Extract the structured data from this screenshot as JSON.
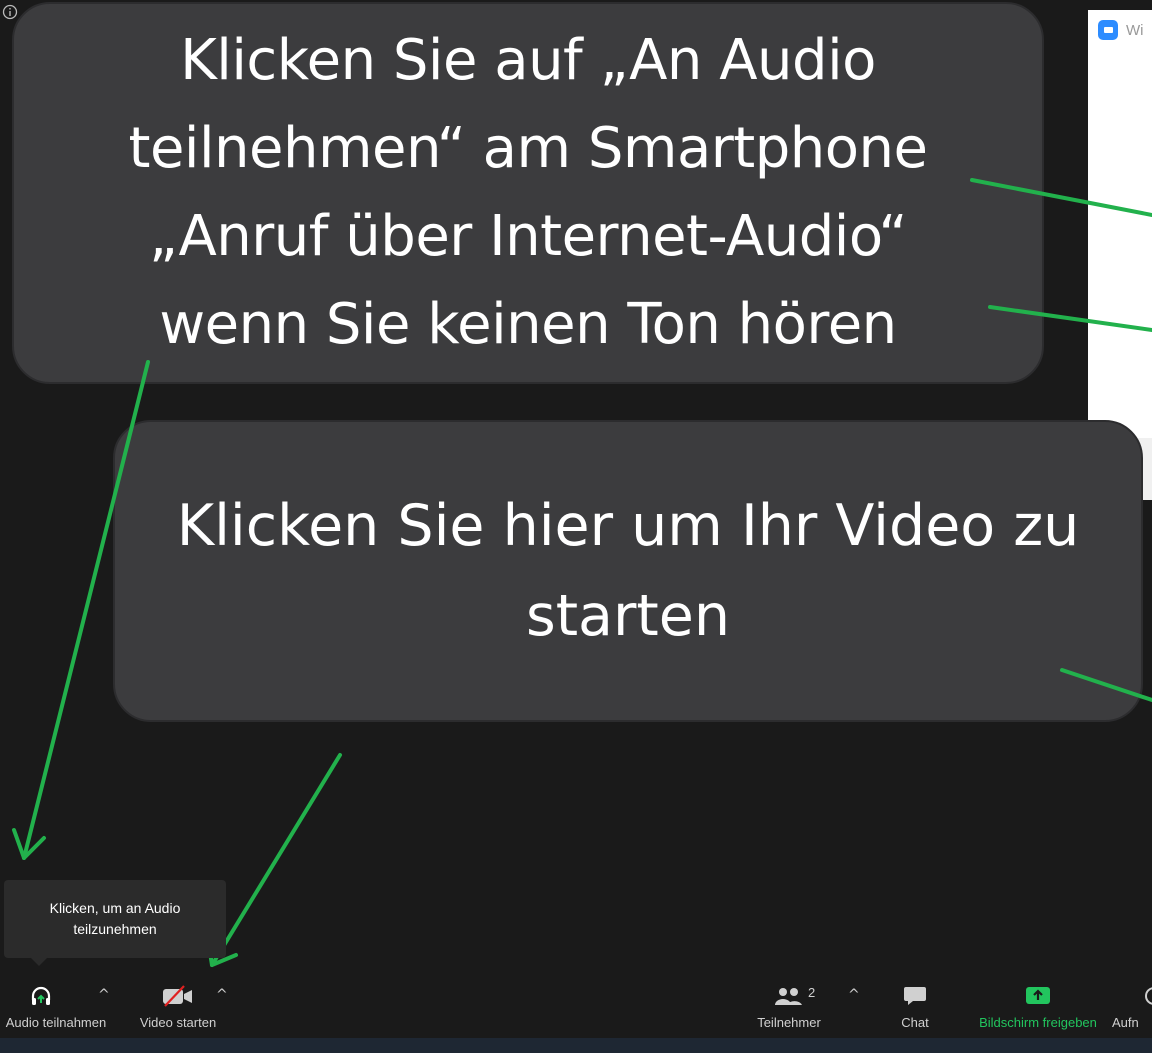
{
  "callouts": {
    "audio": {
      "line1": "Klicken Sie auf „An Audio",
      "line2": "teilnehmen“ am Smartphone",
      "line3": "„Anruf über Internet-Audio“",
      "line4": "wenn Sie keinen Ton hören"
    },
    "video": {
      "line1": "Klicken Sie hier um Ihr Video zu",
      "line2": "starten"
    }
  },
  "dialog": {
    "title": "Wi"
  },
  "tooltip": {
    "line1": "Klicken, um an Audio",
    "line2": "teilzunehmen"
  },
  "toolbar": {
    "audio_label": "Audio teilnahmen",
    "video_label": "Video starten",
    "participants_label": "Teilnehmer",
    "participants_count": "2",
    "chat_label": "Chat",
    "share_label": "Bildschirm freigeben",
    "record_label": "Aufn"
  },
  "colors": {
    "arrow": "#22b14c",
    "share_green": "#22c55e",
    "callout_bg": "#3c3c3e",
    "background": "#1a1a1a"
  },
  "icons": [
    "info-icon",
    "zoom-logo-icon",
    "headphones-icon",
    "video-off-icon",
    "participants-icon",
    "chat-icon",
    "share-screen-icon"
  ]
}
